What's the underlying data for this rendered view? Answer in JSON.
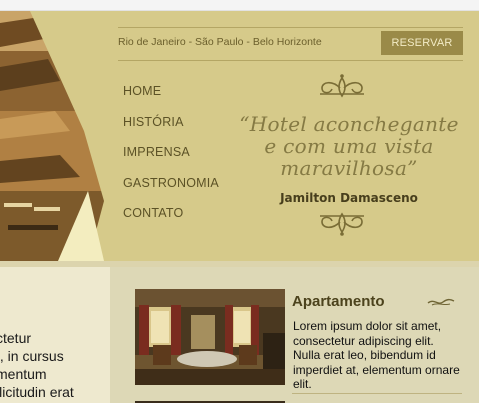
{
  "header": {
    "cities": "Rio de Janeiro - São Paulo - Belo Horizonte",
    "reserve_label": "RESERVAR",
    "nav": [
      "HOME",
      "HISTÓRIA",
      "IMPRENSA",
      "GASTRONOMIA",
      "CONTATO"
    ],
    "quote_lines": [
      "“Hotel aconchegante",
      "e com uma vista",
      "maravilhosa”"
    ],
    "quote_author": "Jamilton Damasceno"
  },
  "left_column": {
    "text_lines": [
      "ctetur",
      "t, in cursus",
      "mentum",
      "llicitudin erat"
    ]
  },
  "room": {
    "title": "Apartamento",
    "description": "Lorem ipsum dolor sit amet, consectetur adipiscing elit. Nulla erat leo, bibendum id imperdiet at, elementum ornare elit."
  },
  "colors": {
    "header_bg": "#d6ca8a",
    "button_bg": "#9a8a48",
    "quote_text": "#857a44",
    "panel_bg": "#ddd8b6"
  },
  "icons": [
    "ornament-top-icon",
    "ornament-bottom-icon",
    "swirl-icon"
  ]
}
